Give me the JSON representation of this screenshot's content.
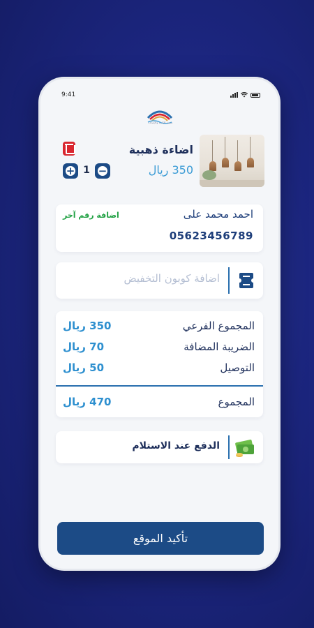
{
  "status_bar": {
    "time": "9:41"
  },
  "brand": {
    "logo_text": "مدينة الإنارة والإضاءة"
  },
  "cart_item": {
    "title": "اضاءة ذهبية",
    "price": "350 ريال",
    "quantity": "1",
    "plus_symbol": "+",
    "minus_symbol": "−",
    "image_icon": "lamps-image"
  },
  "address": {
    "name": "احمد محمد على",
    "phone": "05623456789",
    "add_phone_label": "اضافة رقم آخر"
  },
  "coupon": {
    "placeholder": "اضافة كوبون التخفيض",
    "icon": "coupon-icon"
  },
  "summary": {
    "rows": [
      {
        "label": "المجموع الفرعي",
        "value": "350 ريال"
      },
      {
        "label": "الضريبة المضافة",
        "value": "70 ريال"
      },
      {
        "label": "التوصيل",
        "value": "50 ريال"
      }
    ],
    "total": {
      "label": "المجموع",
      "value": "470 ريال"
    }
  },
  "payment": {
    "method": "الدفع عند الاستلام",
    "icon": "cash-icon"
  },
  "confirm_button": {
    "label": "تأكيد الموقع"
  },
  "colors": {
    "primary": "#1c4b86",
    "accent": "#2d8fcf",
    "danger": "#d9262f",
    "success": "#20a143"
  }
}
